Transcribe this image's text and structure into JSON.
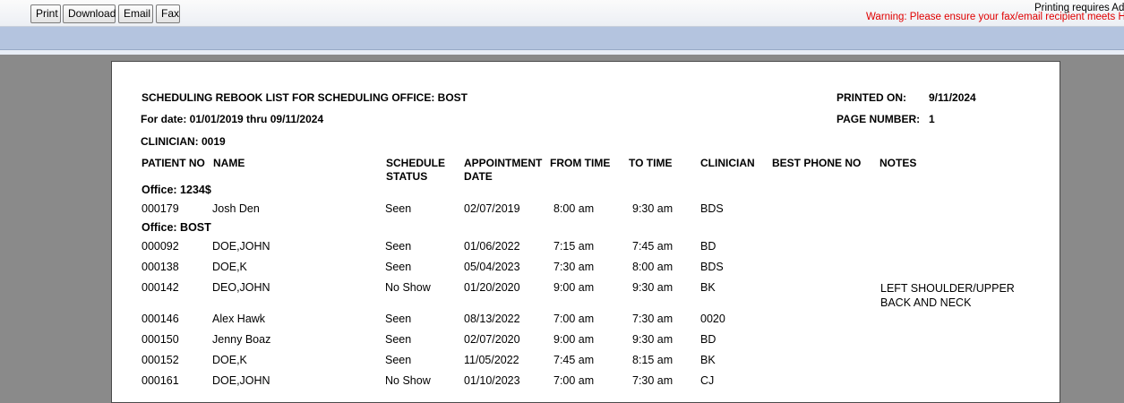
{
  "toolbar": {
    "buttons": [
      "Print",
      "Download",
      "Email",
      "Fax"
    ],
    "requirement_text": "Printing requires Ado",
    "warning_text": "Warning: Please ensure your fax/email recipient meets HIPA"
  },
  "report": {
    "title": "SCHEDULING REBOOK LIST FOR SCHEDULING OFFICE: BOST",
    "date_range": "For date: 01/01/2019 thru 09/11/2024",
    "clinician": "CLINICIAN: 0019",
    "printed_on_label": "PRINTED ON:",
    "printed_on_value": "9/11/2024",
    "page_number_label": "PAGE NUMBER:",
    "page_number_value": "1",
    "columns": [
      "PATIENT NO",
      "NAME",
      "SCHEDULE STATUS",
      "APPOINTMENT DATE",
      "FROM TIME",
      "TO TIME",
      "CLINICIAN",
      "BEST PHONE NO",
      "NOTES"
    ],
    "groups": [
      {
        "office": "Office:  1234$",
        "rows": [
          [
            "000179",
            "Josh Den",
            "Seen",
            "02/07/2019",
            "8:00 am",
            "9:30 am",
            "BDS",
            "",
            ""
          ]
        ]
      },
      {
        "office": "Office:  BOST",
        "rows": [
          [
            "000092",
            "DOE,JOHN",
            "Seen",
            "01/06/2022",
            "7:15 am",
            "7:45 am",
            "BD",
            "",
            ""
          ],
          [
            "000138",
            "DOE,K",
            "Seen",
            "05/04/2023",
            "7:30 am",
            "8:00 am",
            "BDS",
            "",
            ""
          ],
          [
            "000142",
            "DEO,JOHN",
            "No Show",
            "01/20/2020",
            "9:00 am",
            "9:30 am",
            "BK",
            "",
            "LEFT SHOULDER/UPPER BACK AND NECK"
          ],
          [
            "000146",
            "Alex Hawk",
            "Seen",
            "08/13/2022",
            "7:00 am",
            "7:30 am",
            "0020",
            "",
            ""
          ],
          [
            "000150",
            "Jenny Boaz",
            "Seen",
            "02/07/2020",
            "9:00 am",
            "9:30 am",
            "BD",
            "",
            ""
          ],
          [
            "000152",
            "DOE,K",
            "Seen",
            "11/05/2022",
            "7:45 am",
            "8:15 am",
            "BK",
            "",
            ""
          ],
          [
            "000161",
            "DOE,JOHN",
            "No Show",
            "01/10/2023",
            "7:00 am",
            "7:30 am",
            "CJ",
            "",
            ""
          ]
        ]
      }
    ]
  }
}
